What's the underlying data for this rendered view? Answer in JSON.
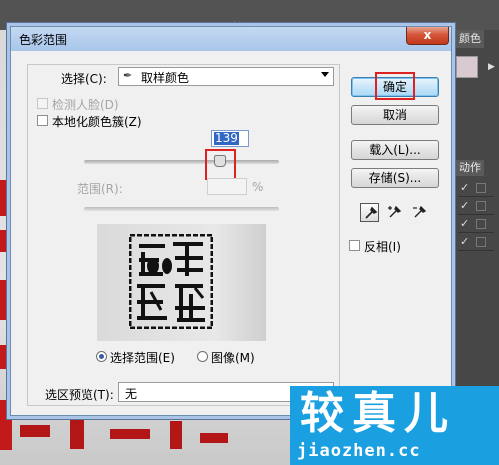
{
  "background": {
    "tab_mark": "×",
    "panel_tab": "颜色",
    "actions_tab": "动作"
  },
  "dialog": {
    "title": "色彩范围",
    "close_label": "x",
    "select_label": "选择(C):",
    "select_value": "取样颜色",
    "detect_faces_label": "检测人脸(D)",
    "localized_label": "本地化颜色簇(Z)",
    "fuzziness_value": "139",
    "range_label": "范围(R):",
    "range_unit": "%",
    "radio_selection_label": "选择范围(E)",
    "radio_image_label": "图像(M)",
    "selection_preview_label": "选区预览(T):",
    "selection_preview_value": "无",
    "ok_label": "确定",
    "cancel_label": "取消",
    "load_label": "载入(L)...",
    "save_label": "存储(S)...",
    "invert_label": "反相(I)"
  },
  "watermark": {
    "big": "较真儿",
    "small": "jiaozhen.cc"
  },
  "colors": {
    "highlight_red": "#dd2222",
    "selection_blue": "#3168c6",
    "watermark_blue": "#1a9fe0"
  }
}
